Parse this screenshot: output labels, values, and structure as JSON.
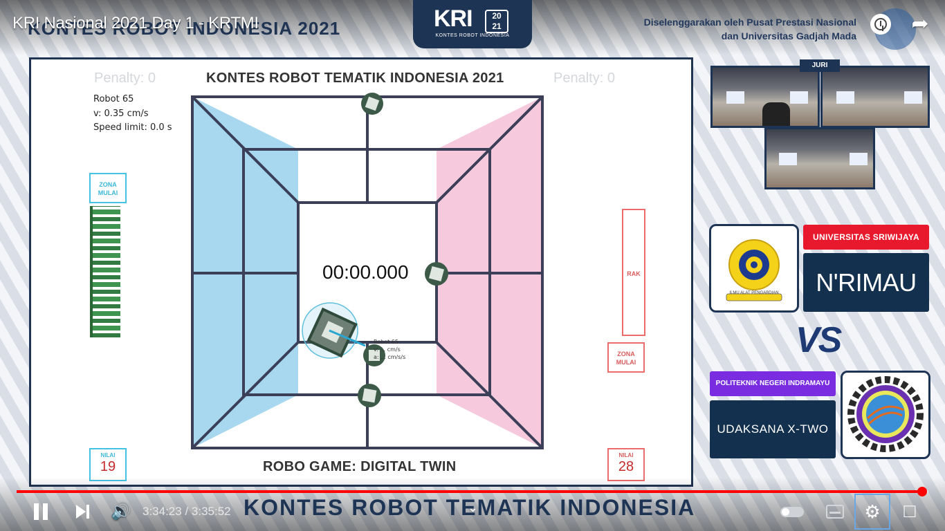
{
  "video": {
    "title": "KRI Nasional 2021 Day 1 - KRTMI",
    "ghost_title": "KONTES ROBOT INDONESIA 2021"
  },
  "header": {
    "logo_mark": "KRI",
    "logo_year": "20 21",
    "logo_sub": "KONTES ROBOT INDONESIA",
    "organizer_line1": "Diselenggarakan oleh Pusat Prestasi Nasional",
    "organizer_line2": "dan Universitas Gadjah Mada"
  },
  "game": {
    "title": "KONTES ROBOT TEMATIK INDONESIA 2021",
    "footer": "ROBO GAME: DIGITAL TWIN",
    "penalty_left": "Penalty:  0",
    "penalty_right": "Penalty:  0",
    "robot_info": {
      "name": "Robot 65",
      "velocity": "v: 0.35 cm/s",
      "speed_limit": "Speed limit: 0.0 s"
    },
    "zone_left": "ZONA\nMULAI",
    "zone_right": "ZONA\nMULAI",
    "rak": "RAK",
    "timer": "00:00.000",
    "robot_label_a": "Robot 65",
    "robot_label_b": "v: ... cm/s",
    "robot_label_c": "a: ... cm/s/s",
    "nilai_label": "NILAI",
    "score_left": "19",
    "score_right": "28",
    "colors": {
      "blue_zone": "#a8d8ef",
      "pink_zone": "#f7c9dd",
      "frame": "#1f3352"
    }
  },
  "juri": {
    "label": "JURI"
  },
  "teams": {
    "team1_university": "UNIVERSITAS SRIWIJAYA",
    "team1_name": "N'RIMAU",
    "team1_logo_text": "ILMU ALAT PENGABDIAN",
    "vs": "VS",
    "team2_university": "POLITEKNIK NEGERI INDRAMAYU",
    "team2_name": "UDAKSANA X-TWO",
    "team2_logo_text": "POLITEKNIK NEGERI INDRAMAYU"
  },
  "player": {
    "current_time": "3:34:23",
    "duration": "3:35:52",
    "time_display": "3:34:23 / 3:35:52",
    "progress_fraction": 0.993,
    "banner": "KONTES ROBOT TEMATIK INDONESIA",
    "icons": [
      "pause-icon",
      "next-icon",
      "volume-icon",
      "autoplay-toggle-icon",
      "captions-icon",
      "settings-icon",
      "fullscreen-exit-icon",
      "clock-icon",
      "share-icon"
    ]
  }
}
